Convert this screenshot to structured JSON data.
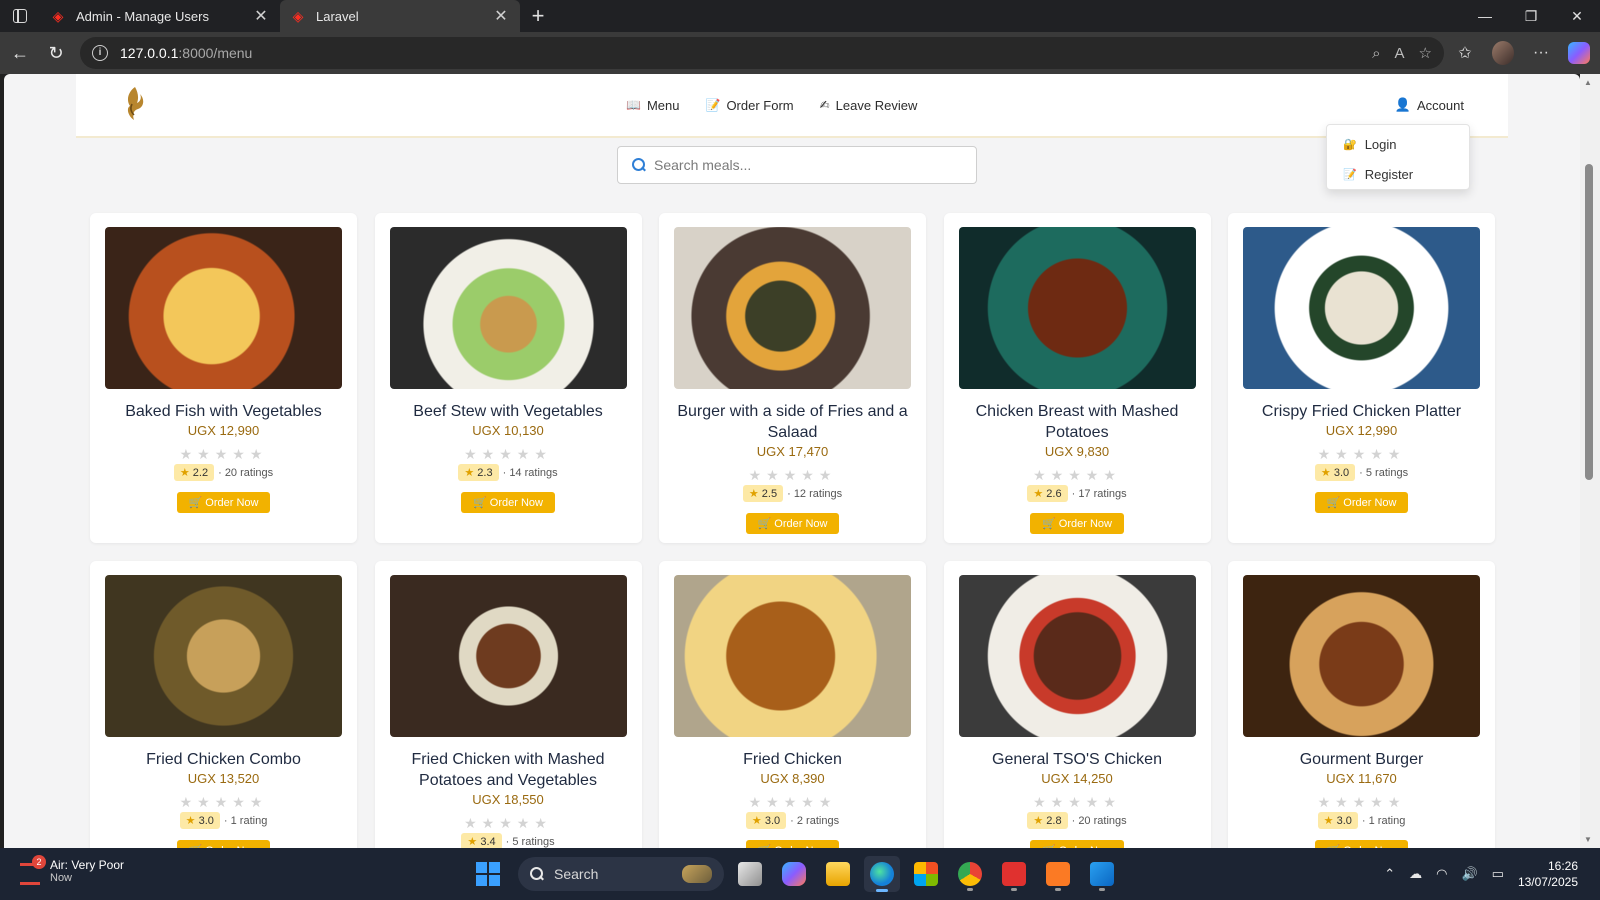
{
  "browser": {
    "tabs": [
      {
        "title": "Admin - Manage Users",
        "active": false
      },
      {
        "title": "Laravel",
        "active": true
      }
    ],
    "url_host": "127.0.0.1",
    "url_path": ":8000/menu"
  },
  "header": {
    "nav": [
      {
        "icon": "menu-icon",
        "label": "Menu"
      },
      {
        "icon": "order-form-icon",
        "label": "Order Form"
      },
      {
        "icon": "review-icon",
        "label": "Leave Review"
      }
    ],
    "account_label": "Account",
    "account_menu": [
      {
        "icon": "login-icon",
        "label": "Login"
      },
      {
        "icon": "register-icon",
        "label": "Register"
      }
    ]
  },
  "search": {
    "placeholder": "Search meals..."
  },
  "order_label": "🛒 Order Now",
  "stars": "★★★★★",
  "meals": [
    {
      "name": "Baked Fish with Vegetables",
      "price": "UGX 12,990",
      "rating": "2.2",
      "count": "· 20 ratings"
    },
    {
      "name": "Beef Stew with Vegetables",
      "price": "UGX 10,130",
      "rating": "2.3",
      "count": "· 14 ratings"
    },
    {
      "name": "Burger with a side of Fries and a Salaad",
      "price": "UGX 17,470",
      "rating": "2.5",
      "count": "· 12 ratings"
    },
    {
      "name": "Chicken Breast with Mashed Potatoes",
      "price": "UGX 9,830",
      "rating": "2.6",
      "count": "· 17 ratings"
    },
    {
      "name": "Crispy Fried Chicken Platter",
      "price": "UGX 12,990",
      "rating": "3.0",
      "count": "· 5 ratings"
    },
    {
      "name": "Fried Chicken Combo",
      "price": "UGX 13,520",
      "rating": "3.0",
      "count": "· 1 rating"
    },
    {
      "name": "Fried Chicken with Mashed Potatoes and Vegetables",
      "price": "UGX 18,550",
      "rating": "3.4",
      "count": "· 5 ratings"
    },
    {
      "name": "Fried Chicken",
      "price": "UGX 8,390",
      "rating": "3.0",
      "count": "· 2 ratings"
    },
    {
      "name": "General TSO'S Chicken",
      "price": "UGX 14,250",
      "rating": "2.8",
      "count": "· 20 ratings"
    },
    {
      "name": "Gourment Burger",
      "price": "UGX 11,670",
      "rating": "3.0",
      "count": "· 1 rating"
    }
  ],
  "taskbar": {
    "weather_badge": "2",
    "weather_line1": "Air: Very Poor",
    "weather_line2": "Now",
    "search_label": "Search",
    "time": "16:26",
    "date": "13/07/2025"
  },
  "colors": {
    "accent": "#f2b200",
    "price": "#9a6a10",
    "title": "#1f2a40"
  }
}
